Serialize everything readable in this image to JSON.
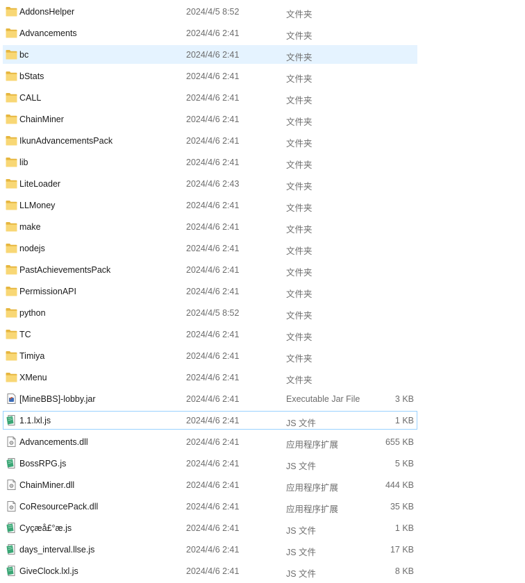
{
  "colors": {
    "folder": "#f8d775",
    "folder_dark": "#e6b63f",
    "hover_bg": "#e5f3ff",
    "focus_border": "#99d1ff",
    "js_icon": "#3aa675",
    "meta_text": "#6d6d6d"
  },
  "files": [
    {
      "name": "AddonsHelper",
      "date": "2024/4/5 8:52",
      "type": "文件夹",
      "size": "",
      "icon": "folder-icon"
    },
    {
      "name": "Advancements",
      "date": "2024/4/6 2:41",
      "type": "文件夹",
      "size": "",
      "icon": "folder-icon"
    },
    {
      "name": "bc",
      "date": "2024/4/6 2:41",
      "type": "文件夹",
      "size": "",
      "icon": "folder-icon",
      "state": "hover"
    },
    {
      "name": "bStats",
      "date": "2024/4/6 2:41",
      "type": "文件夹",
      "size": "",
      "icon": "folder-icon"
    },
    {
      "name": "CALL",
      "date": "2024/4/6 2:41",
      "type": "文件夹",
      "size": "",
      "icon": "folder-icon"
    },
    {
      "name": "ChainMiner",
      "date": "2024/4/6 2:41",
      "type": "文件夹",
      "size": "",
      "icon": "folder-icon"
    },
    {
      "name": "IkunAdvancementsPack",
      "date": "2024/4/6 2:41",
      "type": "文件夹",
      "size": "",
      "icon": "folder-icon"
    },
    {
      "name": "lib",
      "date": "2024/4/6 2:41",
      "type": "文件夹",
      "size": "",
      "icon": "folder-icon"
    },
    {
      "name": "LiteLoader",
      "date": "2024/4/6 2:43",
      "type": "文件夹",
      "size": "",
      "icon": "folder-icon"
    },
    {
      "name": "LLMoney",
      "date": "2024/4/6 2:41",
      "type": "文件夹",
      "size": "",
      "icon": "folder-icon"
    },
    {
      "name": "make",
      "date": "2024/4/6 2:41",
      "type": "文件夹",
      "size": "",
      "icon": "folder-icon"
    },
    {
      "name": "nodejs",
      "date": "2024/4/6 2:41",
      "type": "文件夹",
      "size": "",
      "icon": "folder-icon"
    },
    {
      "name": "PastAchievementsPack",
      "date": "2024/4/6 2:41",
      "type": "文件夹",
      "size": "",
      "icon": "folder-icon"
    },
    {
      "name": "PermissionAPI",
      "date": "2024/4/6 2:41",
      "type": "文件夹",
      "size": "",
      "icon": "folder-icon"
    },
    {
      "name": "python",
      "date": "2024/4/5 8:52",
      "type": "文件夹",
      "size": "",
      "icon": "folder-icon"
    },
    {
      "name": "TC",
      "date": "2024/4/6 2:41",
      "type": "文件夹",
      "size": "",
      "icon": "folder-icon"
    },
    {
      "name": "Timiya",
      "date": "2024/4/6 2:41",
      "type": "文件夹",
      "size": "",
      "icon": "folder-icon"
    },
    {
      "name": "XMenu",
      "date": "2024/4/6 2:41",
      "type": "文件夹",
      "size": "",
      "icon": "folder-icon"
    },
    {
      "name": "[MineBBS]-lobby.jar",
      "date": "2024/4/6 2:41",
      "type": "Executable Jar File",
      "size": "3 KB",
      "icon": "jar-file-icon"
    },
    {
      "name": "1.1.lxl.js",
      "date": "2024/4/6 2:41",
      "type": "JS 文件",
      "size": "1 KB",
      "icon": "js-file-icon",
      "state": "focused"
    },
    {
      "name": "Advancements.dll",
      "date": "2024/4/6 2:41",
      "type": "应用程序扩展",
      "size": "655 KB",
      "icon": "dll-file-icon"
    },
    {
      "name": "BossRPG.js",
      "date": "2024/4/6 2:41",
      "type": "JS 文件",
      "size": "5 KB",
      "icon": "js-file-icon"
    },
    {
      "name": "ChainMiner.dll",
      "date": "2024/4/6 2:41",
      "type": "应用程序扩展",
      "size": "444 KB",
      "icon": "dll-file-icon"
    },
    {
      "name": "CoResourcePack.dll",
      "date": "2024/4/6 2:41",
      "type": "应用程序扩展",
      "size": "35 KB",
      "icon": "dll-file-icon"
    },
    {
      "name": "Cyçæå£°æ.js",
      "date": "2024/4/6 2:41",
      "type": "JS 文件",
      "size": "1 KB",
      "icon": "js-file-icon"
    },
    {
      "name": "days_interval.llse.js",
      "date": "2024/4/6 2:41",
      "type": "JS 文件",
      "size": "17 KB",
      "icon": "js-file-icon"
    },
    {
      "name": "GiveClock.lxl.js",
      "date": "2024/4/6 2:41",
      "type": "JS 文件",
      "size": "8 KB",
      "icon": "js-file-icon"
    }
  ]
}
